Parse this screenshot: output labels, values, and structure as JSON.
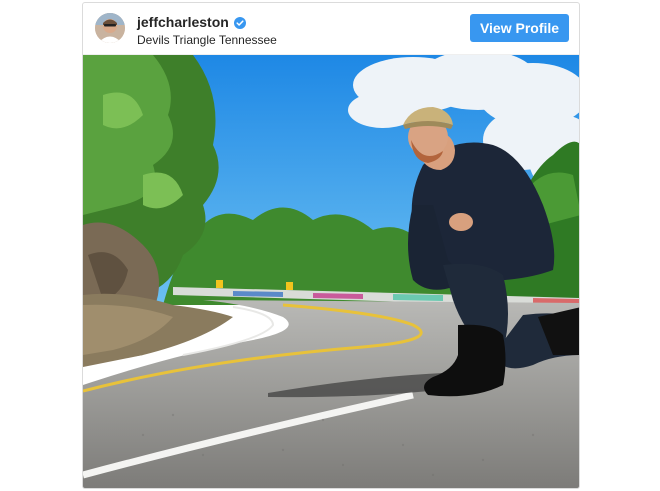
{
  "post": {
    "username": "jeffcharleston",
    "location": "Devils Triangle Tennessee",
    "view_profile_label": "View Profile",
    "verified": true
  },
  "icons": {
    "verified": "verified-badge-icon",
    "avatar": "profile-avatar"
  },
  "colors": {
    "button": "#3897f0",
    "verified": "#3897f0",
    "username": "#262626"
  }
}
